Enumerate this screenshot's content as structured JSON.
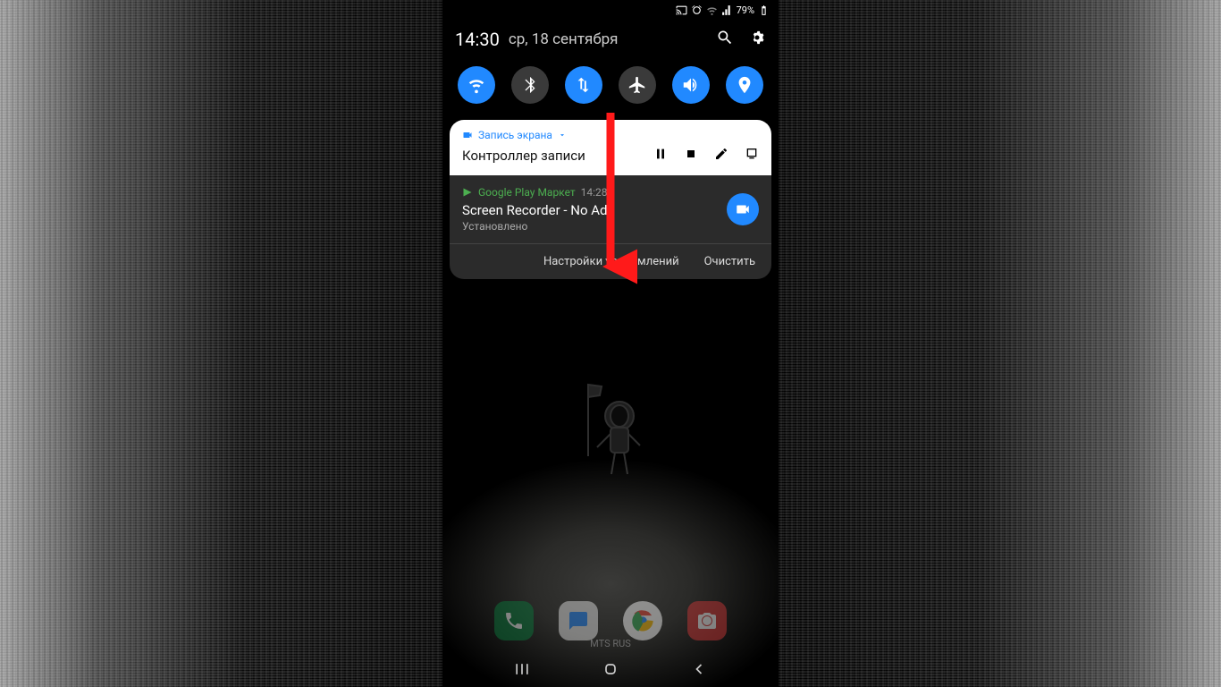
{
  "status": {
    "battery": "79%"
  },
  "header": {
    "time": "14:30",
    "date": "ср, 18 сентября"
  },
  "qs": {
    "wifi": "wifi-icon",
    "bt": "bluetooth-icon",
    "data": "mobile-data-icon",
    "air": "airplane-icon",
    "sound": "sound-icon",
    "loc": "location-icon"
  },
  "notif1": {
    "app": "Запись экрана",
    "title": "Контроллер записи"
  },
  "notif2": {
    "app": "Google Play Маркет",
    "time": "14:28",
    "title": "Screen Recorder - No Ads",
    "sub": "Установлено"
  },
  "footer": {
    "settings": "Настройки уведомлений",
    "clear": "Очистить"
  },
  "carrier": "MTS RUS",
  "colors": {
    "accent": "#2189ff",
    "arrow": "#ff1a1a"
  }
}
